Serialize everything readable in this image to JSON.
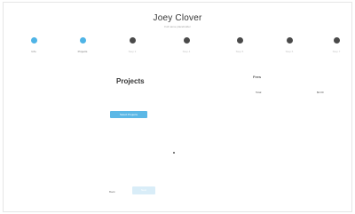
{
  "header": {
    "name": "Joey Clover",
    "subtitle": "Full name placeholder"
  },
  "steps": [
    {
      "label": "Info",
      "state": "done"
    },
    {
      "label": "Projects",
      "state": "done"
    },
    {
      "label": "Step 3",
      "state": "pending"
    },
    {
      "label": "Step 4",
      "state": "pending"
    },
    {
      "label": "Step 5",
      "state": "pending"
    },
    {
      "label": "Step 6",
      "state": "pending"
    },
    {
      "label": "Step 7",
      "state": "pending"
    }
  ],
  "main": {
    "title": "Projects",
    "select_button": "Select Projects"
  },
  "summary": {
    "title": "Fees",
    "total_label": "Total",
    "total_value": "$0.00"
  },
  "footer": {
    "back_label": "Back",
    "next_label": "Next"
  },
  "colors": {
    "accent": "#5cb8e6",
    "step_done": "#4fb4e6",
    "step_pending": "#4a4a4a",
    "next_disabled": "#d9edf8"
  }
}
